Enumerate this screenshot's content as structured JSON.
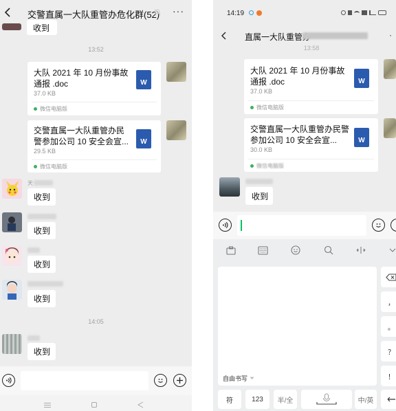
{
  "left": {
    "title": "交警直属一大队重管办危化群(52)",
    "back_icon": "chevron-left-icon",
    "more_label": "···",
    "first_msg": "收到",
    "time1": "13:52",
    "files": [
      {
        "title": "大队 2021 年 10 月份事故通报 .doc",
        "size": "37.0 KB",
        "source": "微信电脑版",
        "badge": "W"
      },
      {
        "title": "交警直属一大队重管办民警参加公司 10 安全会宣...",
        "size": "29.5 KB",
        "source": "微信电脑版",
        "badge": "W"
      }
    ],
    "messages": [
      {
        "nick": "天",
        "text": "收到",
        "avatar": "pikachu-avatar"
      },
      {
        "nick": "",
        "text": "收到",
        "avatar": "figure-avatar"
      },
      {
        "nick": "",
        "text": "收到",
        "avatar": "girl-avatar"
      },
      {
        "nick": "",
        "text": "收到",
        "avatar": "child-avatar"
      }
    ],
    "time2": "14:05",
    "last_msg": "收到"
  },
  "right": {
    "status_time": "14:19",
    "title": "直属一大队重管办",
    "back_icon": "chevron-left-icon",
    "top_time": "13:58",
    "files": [
      {
        "title": "大队 2021 年 10 月份事故通报 .doc",
        "size": "37.0 KB",
        "source": "微信电脑版",
        "badge": "W"
      },
      {
        "title": "交警直属一大队重管办民警参加公司 10 安全会宣...",
        "size": "30.0 KB",
        "source": "微信电脑版",
        "badge": "W"
      }
    ],
    "reply": "收到",
    "handwriting_label": "自由书写",
    "keys": {
      "symbol": "符",
      "num": "123",
      "half": "半/全",
      "lang": "中/英",
      "comma": "，",
      "period": "。",
      "question": "？",
      "exclaim": "！"
    }
  },
  "colors": {
    "bg": "#ededed",
    "word_blue": "#2b5bae",
    "wechat_green": "#40b060",
    "cursor": "#07c160"
  }
}
